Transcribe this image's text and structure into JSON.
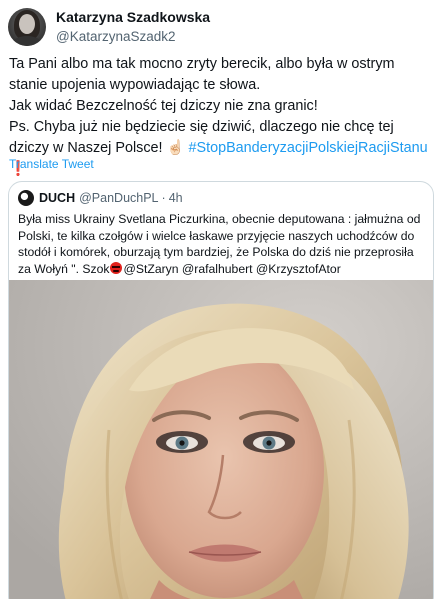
{
  "author": {
    "display_name": "Katarzyna Szadkowska",
    "handle": "@KatarzynaSzadk2"
  },
  "tweet": {
    "line1": "Ta Pani albo ma tak mocno zryty berecik, albo była w ostrym stanie upojenia wypowiadając te słowa.",
    "line2": "Jak widać Bezczelność tej dziczy nie zna granic!",
    "line3_text": "Ps. Chyba już nie będziecie się dziwić, dlaczego nie chcę tej dziczy w Naszej Polsce! ",
    "hashtag": "#StopBanderyzacjiPolskiejRacjiStanu",
    "emoji_hand": "☝🏻",
    "emoji_excl": "❗"
  },
  "translate_label": "Translate Tweet",
  "quoted": {
    "display_name": "DUCH",
    "handle": "@PanDuchPL",
    "separator": "·",
    "time": "4h",
    "text_main": "Była miss Ukrainy Svetlana Piczurkina, obecnie deputowana : jałmużna od Polski, te kilka czołgów i wielce łaskawe przyjęcie naszych uchodźców do stodół i komórek, oburzają tym bardziej, że Polska do dziś nie przeprosiła za Wołyń \". Szok",
    "text_mentions": "@StZaryn @rafalhubert @KrzysztofAtor"
  },
  "colors": {
    "link": "#1d9bf0",
    "secondary_text": "#536471",
    "border": "#cfd9de"
  }
}
